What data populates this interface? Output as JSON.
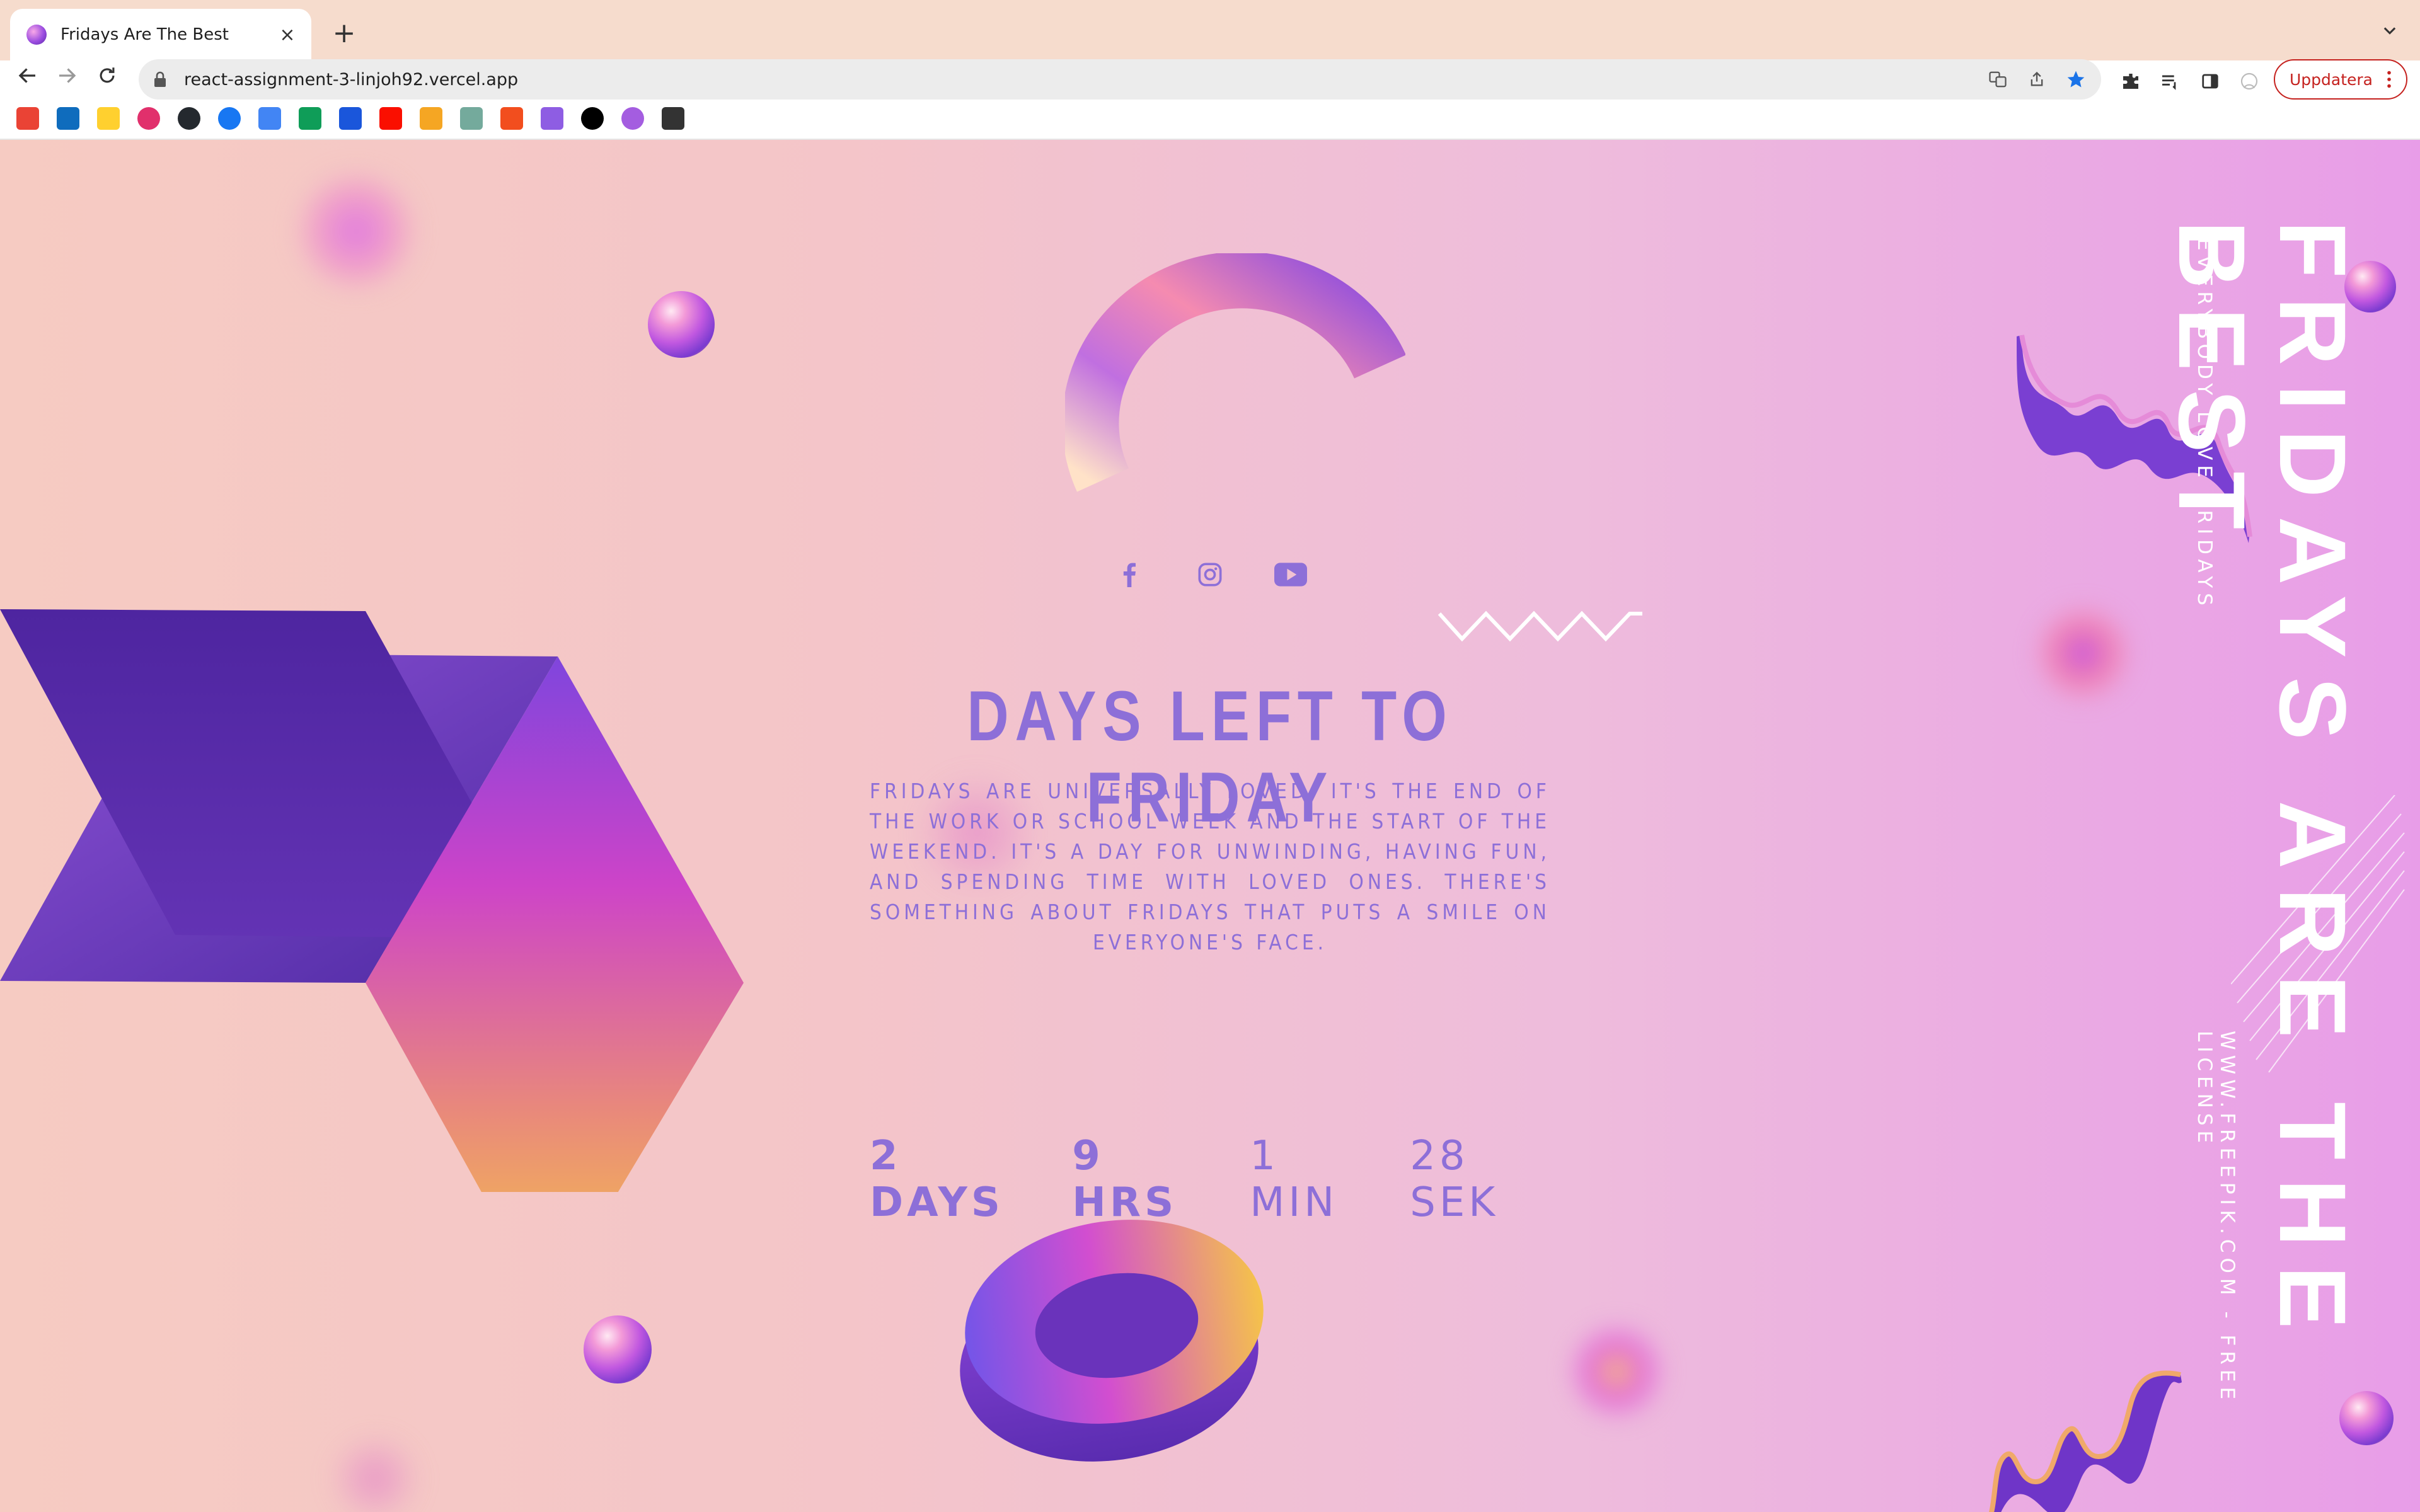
{
  "browser": {
    "tab_title": "Fridays Are The Best",
    "url": "react-assignment-3-linjoh92.vercel.app",
    "update_label": "Uppdatera",
    "new_tab_symbol": "+",
    "close_symbol": "×"
  },
  "bookmarks": [
    {
      "icon": "gmail-icon",
      "color": "#ea4335"
    },
    {
      "icon": "outlook-icon",
      "color": "#0f6cbd"
    },
    {
      "icon": "miro-icon",
      "color": "#ffd02f"
    },
    {
      "icon": "instagram-icon",
      "color": "#e1306c"
    },
    {
      "icon": "github-icon",
      "color": "#24292e"
    },
    {
      "icon": "facebook-icon",
      "color": "#1877f2"
    },
    {
      "icon": "google-docs-icon",
      "color": "#4285f4"
    },
    {
      "icon": "google-sheets-icon",
      "color": "#0f9d58"
    },
    {
      "icon": "b-icon",
      "color": "#1a56db"
    },
    {
      "icon": "adobe-icon",
      "color": "#fa0f00"
    },
    {
      "icon": "k-icon",
      "color": "#f5a623"
    },
    {
      "icon": "chatgpt-icon",
      "color": "#74aa9c"
    },
    {
      "icon": "figma-icon",
      "color": "#f24e1e"
    },
    {
      "icon": "vuetify-icon",
      "color": "#8e5de3"
    },
    {
      "icon": "vercel-icon",
      "color": "#000000"
    },
    {
      "icon": "sphere-icon",
      "color": "#a45de0"
    },
    {
      "icon": "shield-icon",
      "color": "#333333"
    }
  ],
  "page": {
    "heading": "DAYS LEFT TO FRIDAY",
    "description": "Fridays are universally loved. It's the end of the work or school week and the start of the weekend. It's a day for unwinding, having fun, and spending time with loved ones. There's something about Fridays that puts a smile on everyone's face.",
    "countdown": {
      "days": "2 DAYS",
      "hours": "9 HRS",
      "minutes": "1 MIN",
      "seconds": "28 SEK"
    },
    "side_title": "FRIDAYS ARE THE BEST",
    "side_subtitle": "EVERYBODY LOVE FRIDAYS",
    "side_credit": "WWW.FREEPIK.COM - FREE LICENSE",
    "social_icons": [
      "facebook-icon",
      "instagram-icon",
      "youtube-icon"
    ],
    "accent_color": "#8d6fd8"
  }
}
